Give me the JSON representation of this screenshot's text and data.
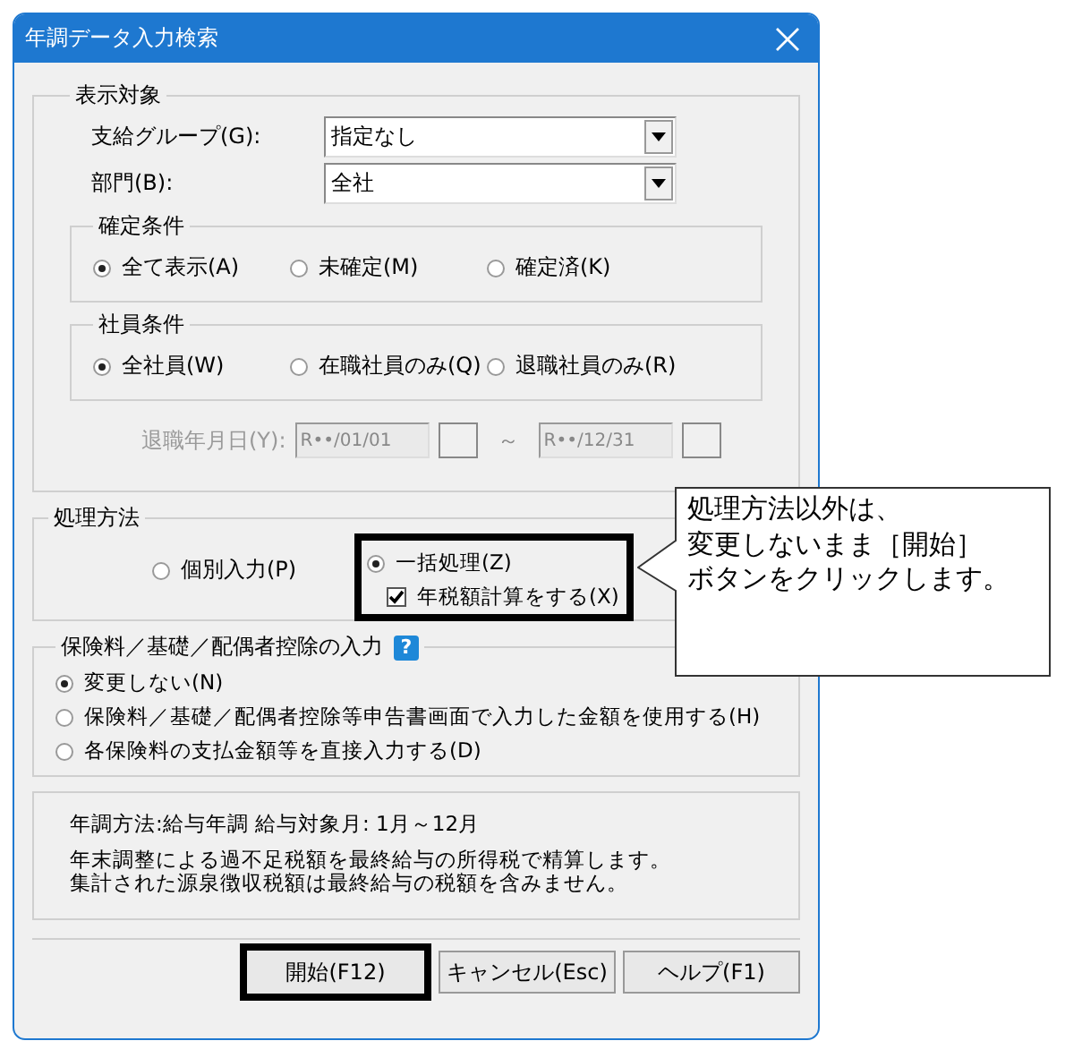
{
  "window": {
    "title": "年調データ入力検索"
  },
  "display_target": {
    "title": "表示対象",
    "fields": [
      {
        "label": "支給グループ(G):",
        "value": "指定なし"
      },
      {
        "label": "部門(B):",
        "value": "全社"
      }
    ],
    "confirm_condition": {
      "title": "確定条件",
      "options": [
        {
          "label": "全て表示(A)",
          "selected": true
        },
        {
          "label": "未確定(M)",
          "selected": false
        },
        {
          "label": "確定済(K)",
          "selected": false
        }
      ]
    },
    "employee_condition": {
      "title": "社員条件",
      "options": [
        {
          "label": "全社員(W)",
          "selected": true
        },
        {
          "label": "在職社員のみ(Q)",
          "selected": false
        },
        {
          "label": "退職社員のみ(R)",
          "selected": false
        }
      ]
    },
    "retirement_date": {
      "label": "退職年月日(Y):",
      "disabled": true,
      "from": "R••/01/01",
      "separator": "～",
      "to": "R••/12/31"
    }
  },
  "processing_method": {
    "title": "処理方法",
    "options": [
      {
        "label": "個別入力(P)",
        "selected": false,
        "highlighted": false
      },
      {
        "label": "一括処理(Z)",
        "selected": true,
        "highlighted": true
      }
    ],
    "checkbox": {
      "label": "年税額計算をする(X)",
      "checked": true
    }
  },
  "insurance_input": {
    "title": "保険料／基礎／配偶者控除の入力",
    "help": "?",
    "options": [
      {
        "label": "変更しない(N)",
        "selected": true
      },
      {
        "label": "保険料／基礎／配偶者控除等申告書画面で入力した金額を使用する(H)",
        "selected": false
      },
      {
        "label": "各保険料の支払金額等を直接入力する(D)",
        "selected": false
      }
    ]
  },
  "info": {
    "summary": "年調方法:給与年調  給与対象月: 1月～12月",
    "notes": [
      "年末調整による過不足税額を最終給与の所得税で精算します。",
      "集計された源泉徴収税額は最終給与の税額を含みません。"
    ]
  },
  "buttons": [
    {
      "label": "開始(F12)",
      "highlighted": true
    },
    {
      "label": "キャンセル(Esc)",
      "highlighted": false
    },
    {
      "label": "ヘルプ(F1)",
      "highlighted": false
    }
  ],
  "callout": {
    "lines": [
      "処理方法以外は、",
      "変更しないまま［開始］",
      "ボタンをクリックします。"
    ]
  }
}
